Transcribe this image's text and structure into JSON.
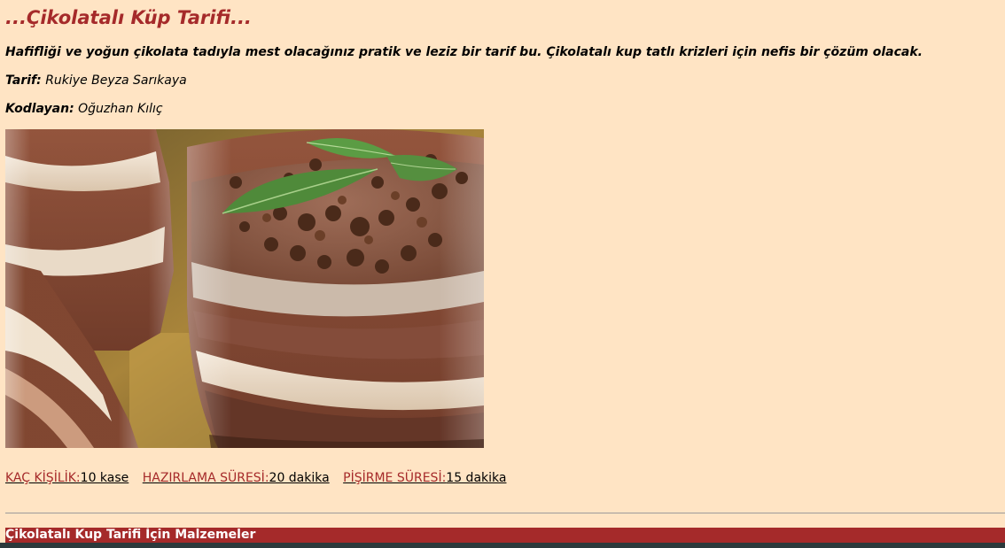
{
  "recipe": {
    "title": "...Çikolatalı Küp Tarifi...",
    "intro": "Hafifliği ve yoğun çikolata tadıyla mest olacağınız pratik ve leziz bir tarif bu. Çikolatalı kup tatlı krizleri için nefis bir çözüm olacak.",
    "recipe_label": "Tarif:",
    "recipe_author": "Rukiye Beyza Sarıkaya",
    "coder_label": "Kodlayan:",
    "coder_name": "Oğuzhan Kılıç",
    "photo_icon": "chocolate-cup-dessert-photo"
  },
  "meta": {
    "servings_label": "KAÇ KİŞİLİK:",
    "servings_value": "10 kase",
    "prep_label": "HAZIRLAMA SÜRESİ:",
    "prep_value": "20 dakika",
    "cook_label": "PİŞİRME SÜRESİ:",
    "cook_value": "15 dakika"
  },
  "ingredients": {
    "heading": "Çikolatalı Kup Tarifi İçin Malzemeler"
  },
  "colors": {
    "page_background": "#ffe4c4",
    "accent": "#a52a2a",
    "text": "#000000"
  }
}
